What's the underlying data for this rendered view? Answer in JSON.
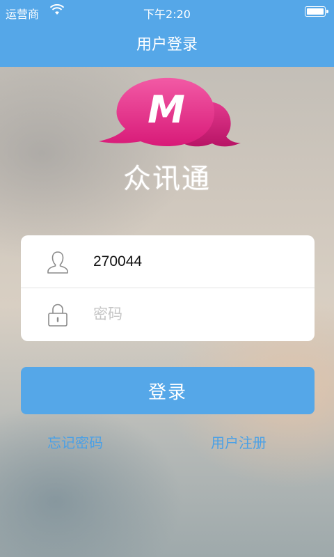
{
  "status_bar": {
    "carrier": "运营商",
    "time": "下午2:20"
  },
  "nav": {
    "title": "用户登录"
  },
  "brand": {
    "logo_letter": "M",
    "app_name": "众讯通"
  },
  "login_form": {
    "username_value": "270044",
    "password_placeholder": "密码"
  },
  "login_button_label": "登录",
  "links": {
    "forgot_password": "忘记密码",
    "register": "用户注册"
  },
  "colors": {
    "accent": "#55a7e8",
    "logo_pink": "#e9358a"
  },
  "icons": {
    "user": "user-icon",
    "password": "lock-icon",
    "wifi": "wifi-icon",
    "battery": "battery-icon"
  }
}
